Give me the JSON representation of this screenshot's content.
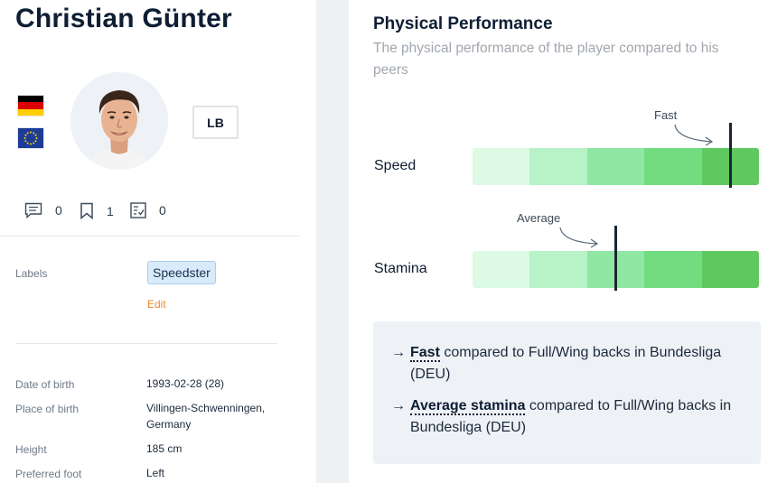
{
  "player": {
    "name": "Christian Günter",
    "position": "LB",
    "flags": [
      "germany-flag-icon",
      "eu-flag-icon"
    ]
  },
  "stats": {
    "comments": "0",
    "bookmarks": "1",
    "checklists": "0"
  },
  "labels": {
    "heading": "Labels",
    "chip": "Speedster",
    "edit": "Edit"
  },
  "details": [
    {
      "label": "Date of birth",
      "value": "1993-02-28 (28)"
    },
    {
      "label": "Place of birth",
      "value": "Villingen-Schwenningen, Germany"
    },
    {
      "label": "Height",
      "value": "185 cm"
    },
    {
      "label": "Preferred foot",
      "value": "Left"
    }
  ],
  "performance": {
    "title": "Physical Performance",
    "subtitle": "The physical performance of the player compared to his peers",
    "metrics": [
      {
        "label": "Speed",
        "annotation": "Fast",
        "percentile": 0.9
      },
      {
        "label": "Stamina",
        "annotation": "Average",
        "percentile": 0.5
      }
    ],
    "segment_colors": [
      "#dcfae4",
      "#b8f2c7",
      "#8ee7a3",
      "#72dc81",
      "#5fc85e"
    ],
    "summary": [
      {
        "arrow": "→",
        "bold": "Fast",
        "rest": " compared to Full/Wing backs in Bundesliga (DEU)"
      },
      {
        "arrow": "→",
        "bold": "Average stamina",
        "rest": " compared to Full/Wing backs in Bundesliga (DEU)"
      }
    ]
  },
  "colors": {
    "accent_orange": "#ef8a2d",
    "chip_bg": "#d9ebfb",
    "marker": "#1b2533"
  }
}
